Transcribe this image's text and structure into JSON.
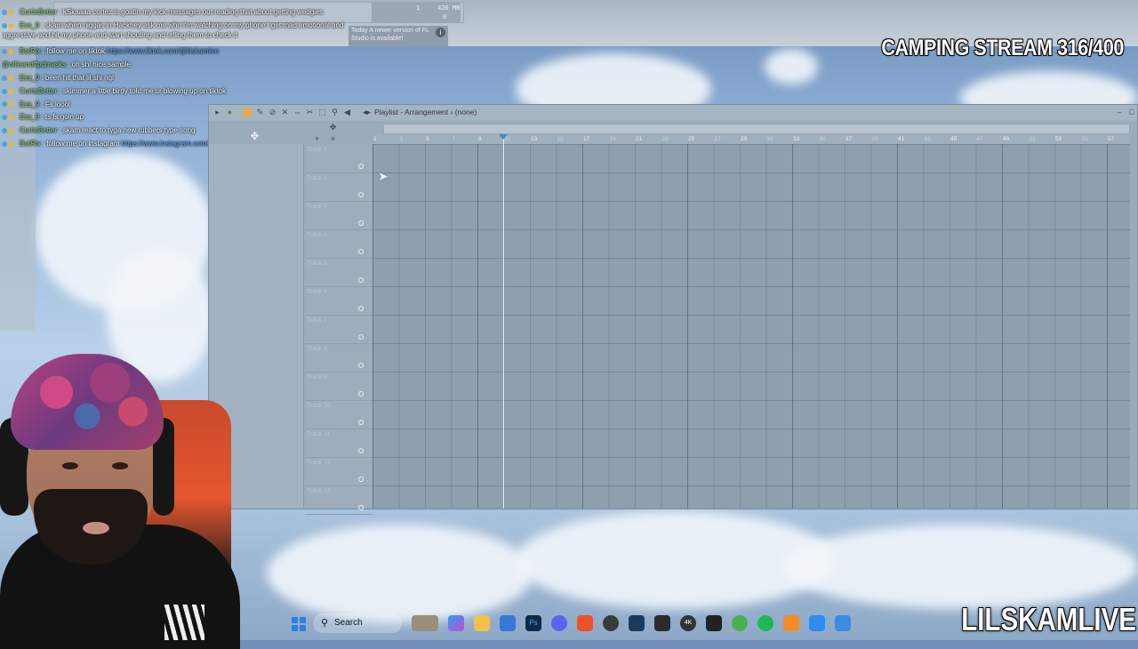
{
  "stream": {
    "title": "CAMPING STREAM 316/400",
    "watermark": "LILSKAMLIVE"
  },
  "fl_studio": {
    "memory": {
      "value_a": "1",
      "value_b": "426 MB",
      "value_c": "0"
    },
    "update_notice": "Today  A newer version of FL Studio is available!"
  },
  "chat": [
    {
      "user": "CurtisBetter",
      "message": "kSkaaaa cortez is goatin my kick messages out reading that about getting wedgies"
    },
    {
      "user": "Ess_9",
      "message": "skam when niggas in Hackney ask me who i'm watching on my phone I get mad emotional and aggressive and hit my phone and start shouting and telling them to check it"
    },
    {
      "user": "BotRix",
      "message": "follow me on tiktok",
      "link": "https://www.tiktok.com/@lilskamlive"
    },
    {
      "user": "@ollieandffpdmasks",
      "message": "oh shi nice sample"
    },
    {
      "user": "Ess_9",
      "message": "been hit that lil shi ngl"
    },
    {
      "user": "CurtisBetter",
      "message": "skimmer a little birdy told me ur blowing up on tiktok"
    },
    {
      "user": "Ess_9",
      "message": "Fs loool"
    },
    {
      "user": "Ess_9",
      "message": "ts fs goin up"
    },
    {
      "user": "CurtisBetter",
      "message": "skam react to tyga new rubbers type song"
    },
    {
      "user": "BotRix",
      "message": "follow me on instagram",
      "link": "https://www.instagram.com/lilskamm/"
    }
  ],
  "playlist": {
    "title": "Playlist - Arrangement",
    "pattern": "(none)",
    "ruler": [
      "1",
      "3",
      "5",
      "7",
      "9",
      "11",
      "13",
      "15",
      "17",
      "19",
      "21",
      "23",
      "25",
      "27",
      "29",
      "31",
      "33",
      "35",
      "37",
      "39",
      "41",
      "43",
      "45",
      "47",
      "49",
      "51",
      "53",
      "55",
      "57"
    ],
    "tracks": [
      "Track 1",
      "Track 2",
      "Track 3",
      "Track 4",
      "Track 5",
      "Track 6",
      "Track 7",
      "Track 8",
      "Track 9",
      "Track 10",
      "Track 11",
      "Track 12",
      "Track 13"
    ]
  },
  "taskbar": {
    "search_label": "Search",
    "apps": [
      "widgets",
      "copilot",
      "file-explorer",
      "store",
      "photoshop",
      "discord",
      "brave",
      "chrome",
      "steam",
      "capcut",
      "4k-downloader",
      "vpn",
      "obs",
      "spotify",
      "fl-studio",
      "edge",
      "notepad"
    ]
  },
  "colors": {
    "sky": "#8fb0d6",
    "playlist_bg": "#8e9fb0",
    "chair": "#e6572f",
    "chat_username": "#8fd17a",
    "chat_link": "#6aa6e8"
  }
}
